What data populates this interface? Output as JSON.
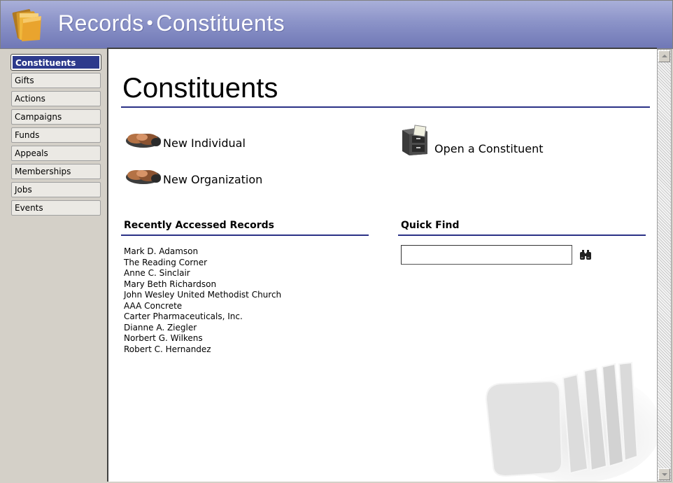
{
  "titlebar": {
    "module": "Records",
    "separator": "•",
    "page": "Constituents",
    "icon": "folders-icon"
  },
  "sidebar": {
    "items": [
      {
        "label": "Constituents",
        "active": true
      },
      {
        "label": "Gifts"
      },
      {
        "label": "Actions"
      },
      {
        "label": "Campaigns"
      },
      {
        "label": "Funds"
      },
      {
        "label": "Appeals"
      },
      {
        "label": "Memberships"
      },
      {
        "label": "Jobs"
      },
      {
        "label": "Events"
      }
    ]
  },
  "main": {
    "title": "Constituents",
    "actions": {
      "new_individual": {
        "label": "New Individual",
        "icon": "handshake-icon"
      },
      "new_organization": {
        "label": "New Organization",
        "icon": "handshake-icon"
      },
      "open_constituent": {
        "label": "Open a Constituent",
        "icon": "file-cabinet-icon"
      }
    },
    "recent": {
      "heading": "Recently Accessed Records",
      "items": [
        "Mark D. Adamson",
        "The Reading Corner",
        "Anne C. Sinclair",
        "Mary Beth Richardson",
        "John Wesley United Methodist Church",
        "AAA Concrete",
        "Carter Pharmaceuticals, Inc.",
        "Dianne A. Ziegler",
        "Norbert G. Wilkens",
        "Robert C. Hernandez"
      ]
    },
    "quick_find": {
      "heading": "Quick Find",
      "value": "",
      "search_icon": "binoculars-icon"
    }
  },
  "colors": {
    "titlebar": "#8b93c8",
    "accent_rule": "#2a3186",
    "active_nav": "#2d3a8c",
    "chrome": "#d4d0c8"
  }
}
